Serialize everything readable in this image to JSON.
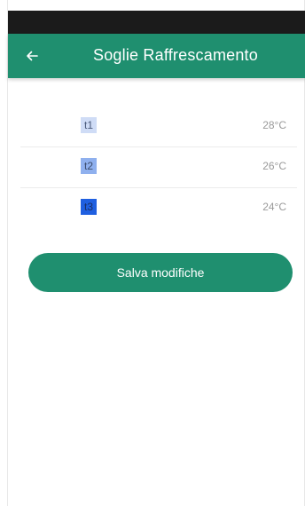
{
  "header": {
    "title": "Soglie Raffrescamento",
    "back_icon": "arrow-left-icon"
  },
  "thresholds": [
    {
      "label": "t1",
      "value": "28°C",
      "badge_color": "#cfdcf6",
      "text_color": "#4a5a7a"
    },
    {
      "label": "t2",
      "value": "26°C",
      "badge_color": "#8fb0ee",
      "text_color": "#3c4c6c"
    },
    {
      "label": "t3",
      "value": "24°C",
      "badge_color": "#1f5fe0",
      "text_color": "#1a2f66"
    }
  ],
  "actions": {
    "save_label": "Salva modifiche"
  },
  "colors": {
    "accent": "#1f8f6f",
    "status_bar": "#1b1b1b"
  }
}
